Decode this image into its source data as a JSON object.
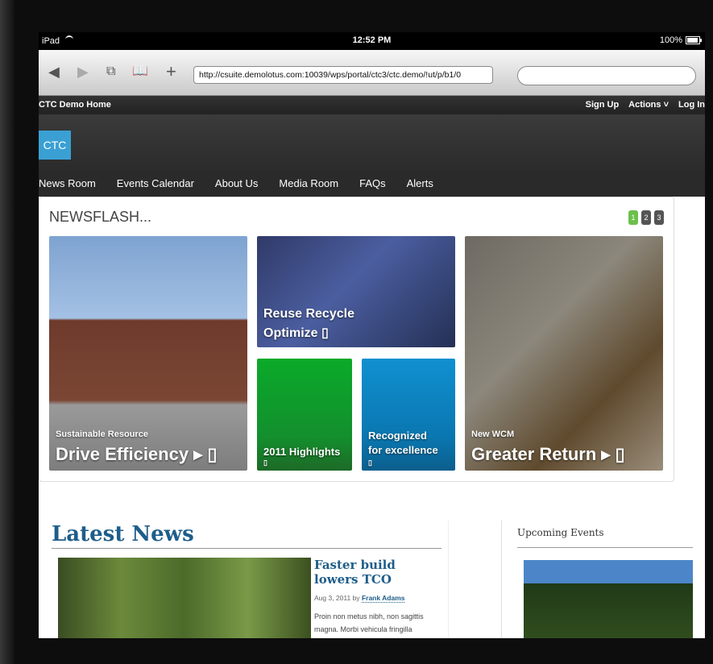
{
  "status_bar": {
    "device": "iPad",
    "time": "12:52 PM",
    "battery": "100%"
  },
  "browser": {
    "url": "http://csuite.demolotus.com:10039/wps/portal/ctc3/ctc.demo/!ut/p/b1/0",
    "search_placeholder": "",
    "icons": [
      "back-arrow-icon",
      "forward-arrow-icon",
      "tabs-icon",
      "bookmarks-icon",
      "add-icon"
    ]
  },
  "site_header": {
    "left_links": "CTC Demo  Home",
    "right_links": [
      "Sign Up",
      "Actions ˅",
      "Log In"
    ],
    "logo_text": "CTC"
  },
  "main_nav": [
    "News Room",
    "Events Calendar",
    "About Us",
    "Media Room",
    "FAQs",
    "Alerts"
  ],
  "newsflash": {
    "title": "NEWSFLASH...",
    "pages": [
      "1",
      "2",
      "3"
    ],
    "tiles": {
      "left": {
        "kicker": "Sustainable Resource",
        "headline": "Drive Efficiency ▸ ▯"
      },
      "mid_top": {
        "headline": "Reuse Recycle",
        "headline2": "Optimize ▯"
      },
      "green": {
        "headline": "2011 Highlights",
        "marker": "▯"
      },
      "blue": {
        "headline": "Recognized",
        "headline2": "for excellence",
        "marker": "▯"
      },
      "right": {
        "kicker": "New WCM",
        "headline": "Greater Return ▸ ▯"
      }
    }
  },
  "latest_news": {
    "title": "Latest News",
    "article": {
      "headline": "Faster build lowers TCO",
      "date": "Aug 3, 2011 by",
      "author": "Frank Adams",
      "body": "Proin non metus nibh, non sagittis magna. Morbi vehicula fringilla"
    }
  },
  "upcoming_events": {
    "title": "Upcoming Events"
  }
}
